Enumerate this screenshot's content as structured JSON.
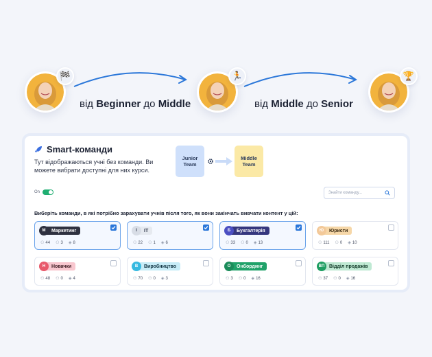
{
  "journey": {
    "step1": {
      "prefix": "від ",
      "from": "Beginner",
      "mid": " до ",
      "to": "Middle"
    },
    "step2": {
      "prefix": "від ",
      "from": "Middle",
      "mid": " до ",
      "to": "Senior"
    },
    "badges": [
      "checkered-flag-icon",
      "runner-icon",
      "trophy-icon"
    ],
    "badge_glyphs": [
      "🏁",
      "🏃",
      "🏆"
    ]
  },
  "panel": {
    "title": "Smart-команди",
    "description": "Тут відображаються учні без команди. Ви можете вибрати доступні для них курси.",
    "tile_from": "Junior Team",
    "tile_to": "Middle Team",
    "toggle_label": "On",
    "search_placeholder": "Знайти команду...",
    "instruction": "Виберіть команди, в які потрібно зарахувати учнів після того, як вони закінчать вивчати контент у цій:"
  },
  "teams": [
    {
      "initial": "М",
      "name": "Маркетинг",
      "learners": "44",
      "admins": "3",
      "courses": "8",
      "selected": true,
      "initial_color": "#2e3140",
      "chip_bg": "#2e3140",
      "chip_fg": "#ffffff"
    },
    {
      "initial": "І",
      "name": "IT",
      "learners": "22",
      "admins": "1",
      "courses": "6",
      "selected": true,
      "initial_color": "#d8dde6",
      "chip_bg": "#e6eaf0",
      "chip_fg": "#2a3346"
    },
    {
      "initial": "Б",
      "name": "Бухгалтерія",
      "learners": "33",
      "admins": "0",
      "courses": "13",
      "selected": true,
      "initial_color": "#4b4fc2",
      "chip_bg": "#35377e",
      "chip_fg": "#ffffff"
    },
    {
      "initial": "Ю",
      "name": "Юристи",
      "learners": "111",
      "admins": "0",
      "courses": "10",
      "selected": false,
      "initial_color": "#f3c999",
      "chip_bg": "#f6d7a8",
      "chip_fg": "#3a2a12"
    },
    {
      "initial": "Н",
      "name": "Новачки",
      "learners": "48",
      "admins": "0",
      "courses": "4",
      "selected": false,
      "initial_color": "#e8596b",
      "chip_bg": "#f8c7cf",
      "chip_fg": "#3a1a20"
    },
    {
      "initial": "В",
      "name": "Виробництво",
      "learners": "70",
      "admins": "0",
      "courses": "3",
      "selected": false,
      "initial_color": "#37b9e0",
      "chip_bg": "#c7ecf7",
      "chip_fg": "#0f3240"
    },
    {
      "initial": "О",
      "name": "Онбординг",
      "learners": "3",
      "admins": "0",
      "courses": "16",
      "selected": false,
      "initial_color": "#1b8c5a",
      "chip_bg": "#21a26a",
      "chip_fg": "#ffffff"
    },
    {
      "initial": "ВП",
      "name": "Відділ продажів",
      "learners": "37",
      "admins": "0",
      "courses": "16",
      "selected": false,
      "initial_color": "#1e9e62",
      "chip_bg": "#bfe9d3",
      "chip_fg": "#103826"
    }
  ],
  "colors": {
    "accent": "#2b77d9",
    "toggle_on": "#1fae71",
    "arrow": "#2b77d9"
  }
}
